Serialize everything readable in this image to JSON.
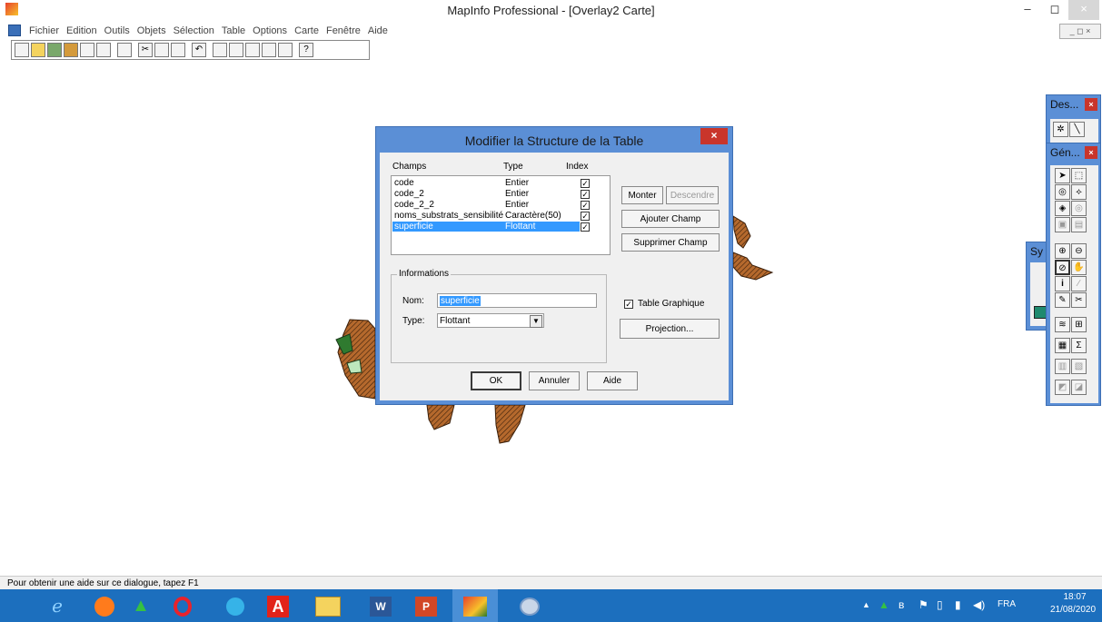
{
  "window": {
    "title": "MapInfo Professional - [Overlay2 Carte]",
    "min": "–",
    "max": "◻",
    "close": "×"
  },
  "menu": [
    "Fichier",
    "Edition",
    "Outils",
    "Objets",
    "Sélection",
    "Table",
    "Options",
    "Carte",
    "Fenêtre",
    "Aide"
  ],
  "dialog": {
    "title": "Modifier la Structure de la Table",
    "close": "×",
    "headers": {
      "champs": "Champs",
      "type": "Type",
      "index": "Index"
    },
    "fields": [
      {
        "name": "code",
        "type": "Entier",
        "indexed": true,
        "selected": false
      },
      {
        "name": "code_2",
        "type": "Entier",
        "indexed": true,
        "selected": false
      },
      {
        "name": "code_2_2",
        "type": "Entier",
        "indexed": true,
        "selected": false
      },
      {
        "name": "noms_substrats_sensibilité",
        "type": "Caractère(50)",
        "indexed": true,
        "selected": false
      },
      {
        "name": "superficie",
        "type": "Flottant",
        "indexed": true,
        "selected": true
      }
    ],
    "buttons": {
      "monter": "Monter",
      "descendre": "Descendre",
      "ajouter": "Ajouter Champ",
      "supprimer": "Supprimer Champ",
      "projection": "Projection...",
      "ok": "OK",
      "annuler": "Annuler",
      "aide": "Aide"
    },
    "info": {
      "legend": "Informations",
      "nom_label": "Nom:",
      "nom_value": "superficie",
      "type_label": "Type:",
      "type_value": "Flottant"
    },
    "table_graphique": {
      "label": "Table Graphique",
      "checked": true
    }
  },
  "palettes": {
    "dessin": {
      "title": "Des..."
    },
    "general": {
      "title": "Gén..."
    },
    "symbole": {
      "title": "Sy"
    }
  },
  "status": "Pour obtenir une aide sur ce dialogue, tapez F1",
  "tray": {
    "lang": "FRA",
    "time": "18:07",
    "date": "21/08/2020"
  }
}
